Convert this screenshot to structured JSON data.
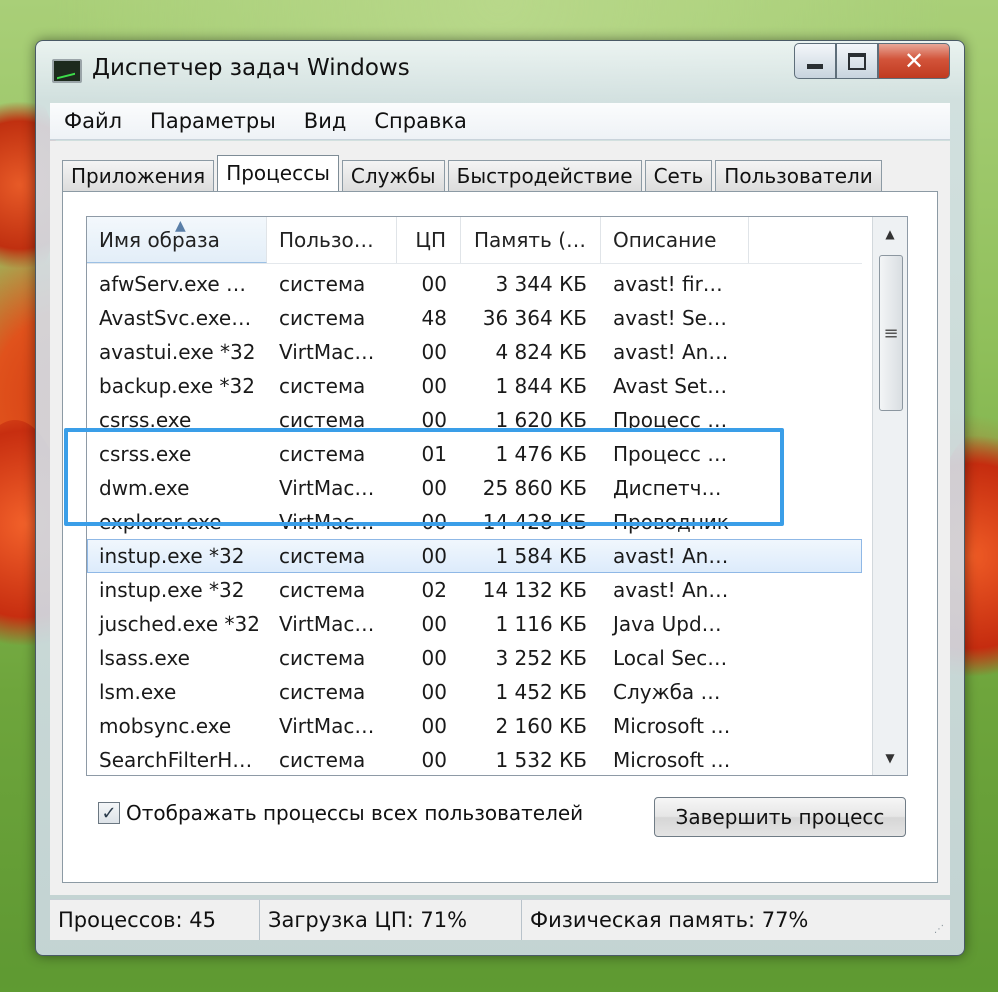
{
  "window": {
    "title": "Диспетчер задач Windows",
    "controls": {
      "minimize": "–",
      "maximize": "□",
      "close": "✕"
    }
  },
  "menu": [
    "Файл",
    "Параметры",
    "Вид",
    "Справка"
  ],
  "tabs": [
    {
      "label": "Приложения",
      "active": false
    },
    {
      "label": "Процессы",
      "active": true
    },
    {
      "label": "Службы",
      "active": false
    },
    {
      "label": "Быстродействие",
      "active": false
    },
    {
      "label": "Сеть",
      "active": false
    },
    {
      "label": "Пользователи",
      "active": false
    }
  ],
  "columns": {
    "image_name": "Имя образа",
    "user": "Пользо…",
    "cpu": "ЦП",
    "memory": "Память (…",
    "description": "Описание"
  },
  "sort_indicator": "▲",
  "processes": [
    {
      "name": "afwServ.exe …",
      "user": "система",
      "cpu": "00",
      "memory": "3 344 КБ",
      "description": "avast! fir…"
    },
    {
      "name": "AvastSvc.exe…",
      "user": "система",
      "cpu": "48",
      "memory": "36 364 КБ",
      "description": "avast! Se…"
    },
    {
      "name": "avastui.exe *32",
      "user": "VirtMac…",
      "cpu": "00",
      "memory": "4 824 КБ",
      "description": "avast! An…"
    },
    {
      "name": "backup.exe *32",
      "user": "система",
      "cpu": "00",
      "memory": "1 844 КБ",
      "description": "Avast Set…"
    },
    {
      "name": "csrss.exe",
      "user": "система",
      "cpu": "00",
      "memory": "1 620 КБ",
      "description": "Процесс …"
    },
    {
      "name": "csrss.exe",
      "user": "система",
      "cpu": "01",
      "memory": "1 476 КБ",
      "description": "Процесс …"
    },
    {
      "name": "dwm.exe",
      "user": "VirtMac…",
      "cpu": "00",
      "memory": "25 860 КБ",
      "description": "Диспетч…"
    },
    {
      "name": "explorer.exe",
      "user": "VirtMac…",
      "cpu": "00",
      "memory": "14 428 КБ",
      "description": "Проводник"
    },
    {
      "name": "instup.exe *32",
      "user": "система",
      "cpu": "00",
      "memory": "1 584 КБ",
      "description": "avast! An…",
      "selected": true
    },
    {
      "name": "instup.exe *32",
      "user": "система",
      "cpu": "02",
      "memory": "14 132 КБ",
      "description": "avast! An…"
    },
    {
      "name": "jusched.exe *32",
      "user": "VirtMac…",
      "cpu": "00",
      "memory": "1 116 КБ",
      "description": "Java Upd…"
    },
    {
      "name": "lsass.exe",
      "user": "система",
      "cpu": "00",
      "memory": "3 252 КБ",
      "description": "Local Sec…"
    },
    {
      "name": "lsm.exe",
      "user": "система",
      "cpu": "00",
      "memory": "1 452 КБ",
      "description": "Служба …"
    },
    {
      "name": "mobsync.exe",
      "user": "VirtMac…",
      "cpu": "00",
      "memory": "2 160 КБ",
      "description": "Microsoft …"
    },
    {
      "name": "SearchFilterH…",
      "user": "система",
      "cpu": "00",
      "memory": "1 532 КБ",
      "description": "Microsoft …"
    }
  ],
  "scrollbar": {
    "up": "▲",
    "down": "▼",
    "thumb_grip": "≡"
  },
  "show_all_users": {
    "checked": true,
    "mark": "✓",
    "label": "Отображать процессы всех пользователей"
  },
  "end_process_button": "Завершить процесс",
  "status": {
    "processes": "Процессов: 45",
    "cpu": "Загрузка ЦП: 71%",
    "memory": "Физическая память: 77%"
  },
  "colors": {
    "highlight_border": "#3a9ee8",
    "selected_row": "#dcebfb"
  }
}
